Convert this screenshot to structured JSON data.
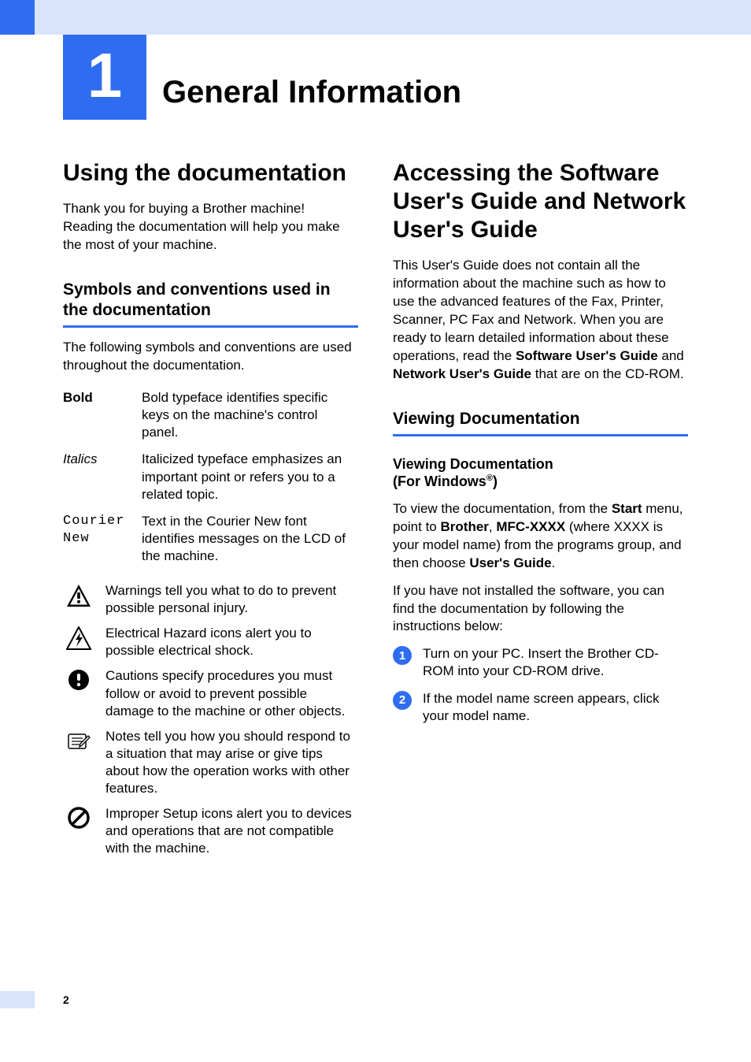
{
  "chapter": {
    "number": "1",
    "title": "General Information"
  },
  "left": {
    "title": "Using the documentation",
    "intro": "Thank you for buying a Brother machine! Reading the documentation will help you make the most of your machine.",
    "sub1": "Symbols and conventions used in the documentation",
    "sub1_body": "The following symbols and conventions are used throughout the documentation.",
    "typefaces": {
      "bold_label": "Bold",
      "bold_desc": "Bold typeface identifies specific keys on the machine's control panel.",
      "italics_label": "Italics",
      "italics_desc": "Italicized typeface emphasizes an important point or refers you to a related topic.",
      "courier_label": "Courier New",
      "courier_desc": "Text in the Courier New font identifies messages on the LCD of the machine."
    },
    "icons": {
      "warning": "Warnings tell you what to do to prevent possible personal injury.",
      "electrical": "Electrical Hazard icons alert you to possible electrical shock.",
      "caution": "Cautions specify procedures you must follow or avoid to prevent possible damage to the machine or other objects.",
      "note": "Notes tell you how you should respond to a situation that may arise or give tips about how the operation works with other features.",
      "improper": "Improper Setup icons alert you to devices and operations that are not compatible with the machine."
    }
  },
  "right": {
    "title": "Accessing the Software User's Guide and Network User's Guide",
    "intro_pre": "This User's Guide does not contain all the information about the machine such as how to use the advanced features of the Fax, Printer, Scanner, PC Fax and Network. When you are ready to learn detailed information about these operations, read the ",
    "intro_b1": "Software User's Guide",
    "intro_mid": " and ",
    "intro_b2": "Network User's Guide",
    "intro_post": " that are on the CD-ROM.",
    "sub1": "Viewing Documentation",
    "mini_title1": "Viewing Documentation ",
    "mini_title2": "(For Windows",
    "mini_sup": "®",
    "mini_title3": ")",
    "p1_a": "To view the documentation, from the ",
    "p1_b1": "Start",
    "p1_b": " menu, point to ",
    "p1_b2": "Brother",
    "p1_c": ", ",
    "p1_b3": "MFC-XXXX",
    "p1_d": " (where XXXX is your model name) from the programs group, and then choose ",
    "p1_b4": "User's Guide",
    "p1_e": ".",
    "p2": "If you have not installed the software, you can find the documentation by following the instructions below:",
    "step1_num": "1",
    "step1": "Turn on your PC. Insert the Brother CD-ROM into your CD-ROM drive.",
    "step2_num": "2",
    "step2": "If the model name screen appears, click your model name."
  },
  "page": "2"
}
